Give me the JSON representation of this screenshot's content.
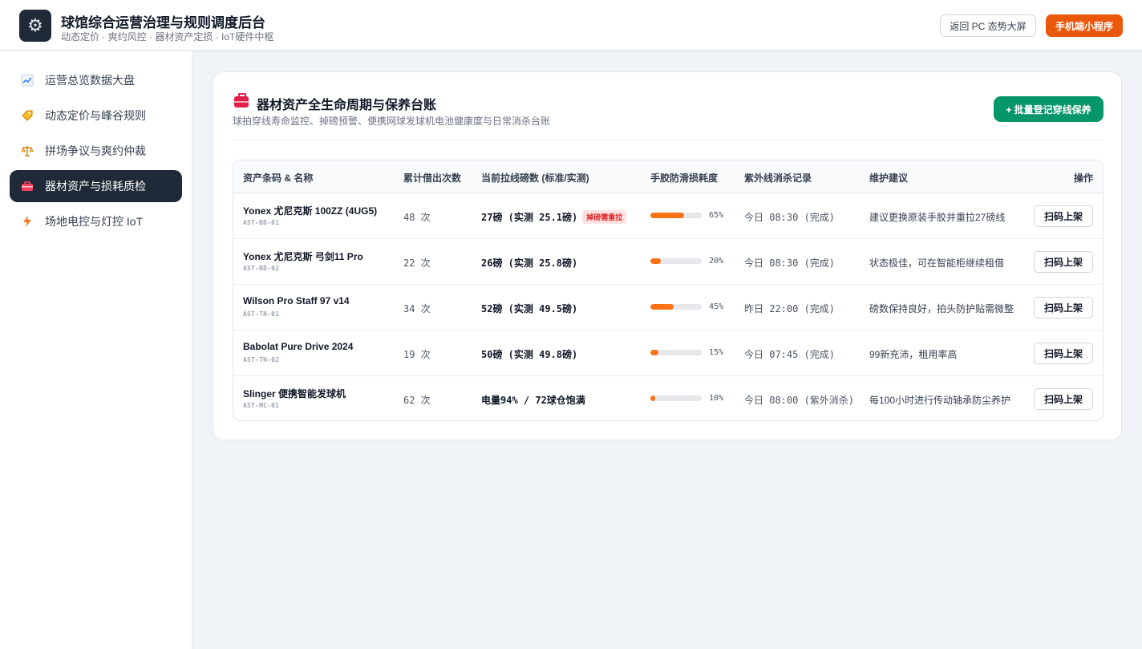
{
  "header": {
    "logo_icon": "gear-icon",
    "title": "球馆综合运营治理与规则调度后台",
    "subtitle": "动态定价 · 爽约风控 · 器材资产定损 · IoT硬件中枢",
    "back_button": "返回 PC 态势大屏",
    "mini_program_button": "手机端小程序",
    "accent_color": "#ea580c"
  },
  "sidebar": {
    "items": [
      {
        "label": "运营总览数据大盘",
        "icon": "chart-icon",
        "active": false
      },
      {
        "label": "动态定价与峰谷规则",
        "icon": "price-tag-icon",
        "active": false
      },
      {
        "label": "拼场争议与爽约仲裁",
        "icon": "scales-icon",
        "active": false
      },
      {
        "label": "器材资产与损耗质检",
        "icon": "toolbox-icon",
        "active": true
      },
      {
        "label": "场地电控与灯控 IoT",
        "icon": "lightning-icon",
        "active": false
      }
    ]
  },
  "main": {
    "card": {
      "icon": "toolbox-icon",
      "title": "器材资产全生命周期与保养台账",
      "subtitle": "球拍穿线寿命监控、掉磅预警、便携网球发球机电池健康度与日常消杀台账",
      "batch_button": "+ 批量登记穿线保养"
    },
    "table": {
      "headers": [
        "资产条码 & 名称",
        "累计借出次数",
        "当前拉线磅数 (标准/实测)",
        "手胶防滑损耗度",
        "紫外线消杀记录",
        "维护建议",
        "操作"
      ],
      "rows": [
        {
          "name": "Yonex 尤尼克斯 100ZZ (4UG5)",
          "code": "AST-BD-01",
          "borrow": "48 次",
          "tension": "27磅 (实测 25.1磅)",
          "badge": "掉磅需重拉",
          "wear": 65,
          "wear_label": "65%",
          "uv": "今日 08:30 (完成)",
          "advice": "建议更换原装手胶并重拉27磅线",
          "action": "扫码上架"
        },
        {
          "name": "Yonex 尤尼克斯 弓剑11 Pro",
          "code": "AST-BD-02",
          "borrow": "22 次",
          "tension": "26磅 (实测 25.8磅)",
          "badge": "",
          "wear": 20,
          "wear_label": "20%",
          "uv": "今日 08:30 (完成)",
          "advice": "状态极佳，可在智能柜继续租借",
          "action": "扫码上架"
        },
        {
          "name": "Wilson Pro Staff 97 v14",
          "code": "AST-TN-01",
          "borrow": "34 次",
          "tension": "52磅 (实测 49.5磅)",
          "badge": "",
          "wear": 45,
          "wear_label": "45%",
          "uv": "昨日 22:00 (完成)",
          "advice": "磅数保持良好，拍头防护贴需微整",
          "action": "扫码上架"
        },
        {
          "name": "Babolat Pure Drive 2024",
          "code": "AST-TN-02",
          "borrow": "19 次",
          "tension": "50磅 (实测 49.8磅)",
          "badge": "",
          "wear": 15,
          "wear_label": "15%",
          "uv": "今日 07:45 (完成)",
          "advice": "99新充沛，租用率高",
          "action": "扫码上架"
        },
        {
          "name": "Slinger 便携智能发球机",
          "code": "AST-MC-01",
          "borrow": "62 次",
          "tension": "电量94% / 72球仓饱满",
          "badge": "",
          "wear": 10,
          "wear_label": "10%",
          "uv": "今日 08:00 (紫外消杀)",
          "advice": "每100小时进行传动轴承防尘养护",
          "action": "扫码上架"
        }
      ]
    }
  }
}
